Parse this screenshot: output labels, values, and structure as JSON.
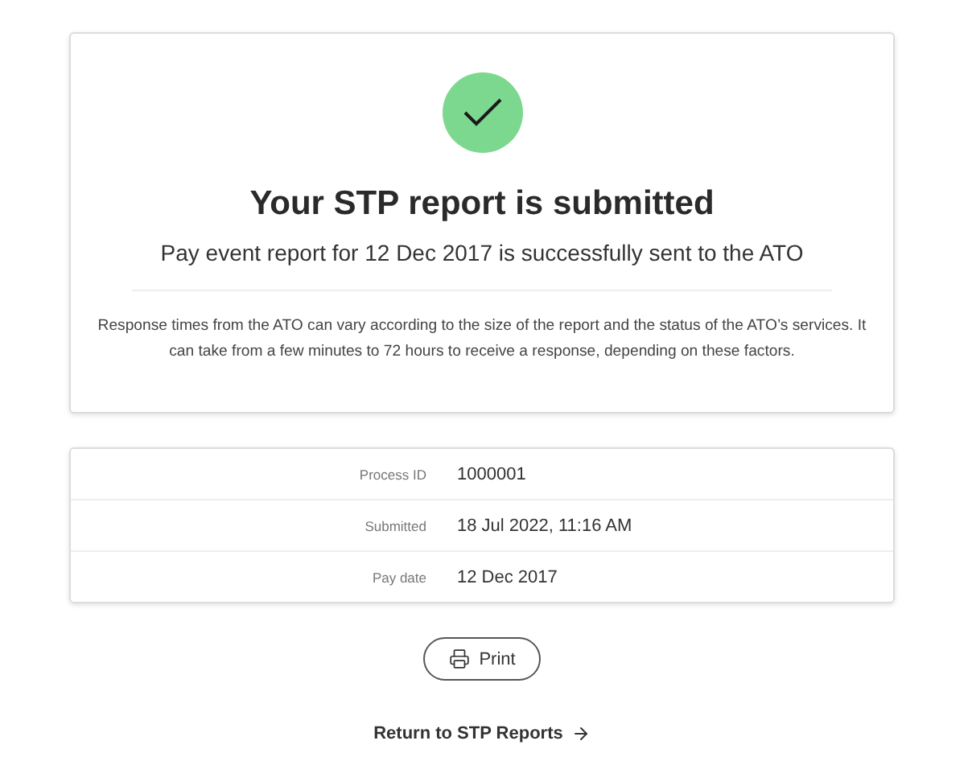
{
  "confirmation": {
    "title": "Your STP report is submitted",
    "subtitle": "Pay event report for 12 Dec 2017 is successfully sent to the ATO",
    "note": "Response times from the ATO can vary according to the size of the report and the status of the ATO’s services. It can take from a few minutes to 72 hours to receive a response, depending on these factors."
  },
  "details": [
    {
      "label": "Process ID",
      "value": "1000001"
    },
    {
      "label": "Submitted",
      "value": "18 Jul 2022, 11:16 AM"
    },
    {
      "label": "Pay date",
      "value": "12 Dec 2017"
    }
  ],
  "print_button": {
    "label": "Print"
  },
  "return_link": {
    "label": "Return to STP Reports"
  }
}
